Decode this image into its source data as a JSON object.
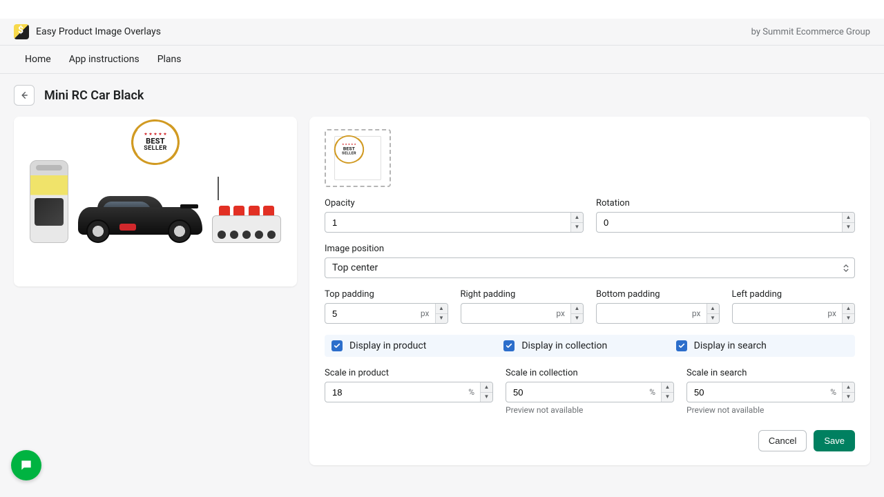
{
  "app": {
    "title": "Easy Product Image Overlays",
    "vendor": "by Summit Ecommerce Group"
  },
  "nav": {
    "home": "Home",
    "instructions": "App instructions",
    "plans": "Plans"
  },
  "page": {
    "title": "Mini RC Car Black"
  },
  "overlay_badge": {
    "line1": "BEST",
    "line2": "SELLER"
  },
  "fields": {
    "opacity": {
      "label": "Opacity",
      "value": "1"
    },
    "rotation": {
      "label": "Rotation",
      "value": "0"
    },
    "image_position": {
      "label": "Image position",
      "value": "Top center"
    },
    "top_padding": {
      "label": "Top padding",
      "value": "5",
      "unit": "px"
    },
    "right_padding": {
      "label": "Right padding",
      "value": "",
      "unit": "px"
    },
    "bottom_padding": {
      "label": "Bottom padding",
      "value": "",
      "unit": "px"
    },
    "left_padding": {
      "label": "Left padding",
      "value": "",
      "unit": "px"
    }
  },
  "checks": {
    "product": "Display in product",
    "collection": "Display in collection",
    "search": "Display in search"
  },
  "scales": {
    "product": {
      "label": "Scale in product",
      "value": "18",
      "unit": "%"
    },
    "collection": {
      "label": "Scale in collection",
      "value": "50",
      "unit": "%",
      "note": "Preview not available"
    },
    "search": {
      "label": "Scale in search",
      "value": "50",
      "unit": "%",
      "note": "Preview not available"
    }
  },
  "actions": {
    "cancel": "Cancel",
    "save": "Save"
  }
}
